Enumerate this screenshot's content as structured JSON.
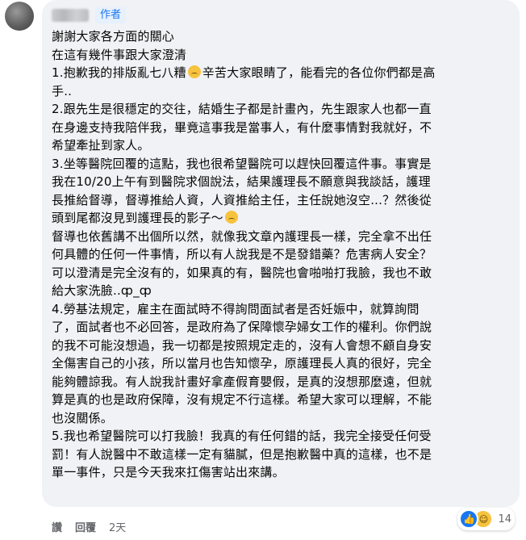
{
  "comment": {
    "author_badge": "作者",
    "lines": [
      "謝謝大家各方面的關心",
      "在這有幾件事跟大家澄清",
      "1.抱歉我的排版亂七八糟",
      "辛苦大家眼睛了，能看完的各位你們都是高",
      "手..",
      "2.跟先生是很穩定的交往，結婚生子都是計畫內，先生跟家人也都一直",
      "在身邊支持我陪伴我，畢竟這事我是當事人，有什麼事情對我就好，不",
      "希望牽扯到家人。",
      "3.坐等醫院回覆的這點，我也很希望醫院可以趕快回覆這件事。事實是",
      "我在10/20上午有到醫院求個說法，結果護理長不願意與我談話，護理",
      "長推給督導，督導推給人資，人資推給主任，主任說她沒空...？然後從",
      "頭到尾都沒見到護理長的影子～",
      "督導也依舊講不出個所以然，就像我文章內護理長一樣，完全拿不出任",
      "何具體的任何一件事情，所以有人說我是不是發錯藥？危害病人安全？",
      "可以澄清是完全沒有的，如果真的有，醫院也會啪啪打我臉，我也不敢",
      "給大家洗臉..ȹ_ȹ",
      "4.勞基法規定，雇主在面試時不得詢問面試者是否妊娠中，就算詢問",
      "了，面試者也不必回答，是政府為了保障懷孕婦女工作的權利。你們說",
      "的我不可能沒想過，我一切都是按照規定走的，沒有人會想不顧自身安",
      "全傷害自己的小孩，所以當月也告知懷孕，原護理長人真的很好，完全",
      "能夠體諒我。有人說我計畫好拿產假育嬰假，是真的沒想那麼遠，但就",
      "算是真的也是政府保障，沒有規定不行這樣。希望大家可以理解，不能",
      "也沒關係。",
      "5.我也希望醫院可以打我臉！我真的有任何錯的話，我完全接受任何受",
      "罰！有人說醫中不敢這樣一定有貓膩，但是抱歉醫中真的這樣，也不是",
      "單一事件，只是今天我來扛傷害站出來講。"
    ]
  },
  "reactions": {
    "icons": [
      "like-icon",
      "haha-icon"
    ],
    "count": "14"
  },
  "actions": {
    "like_label": "讚",
    "reply_label": "回覆",
    "timestamp": "2天"
  }
}
